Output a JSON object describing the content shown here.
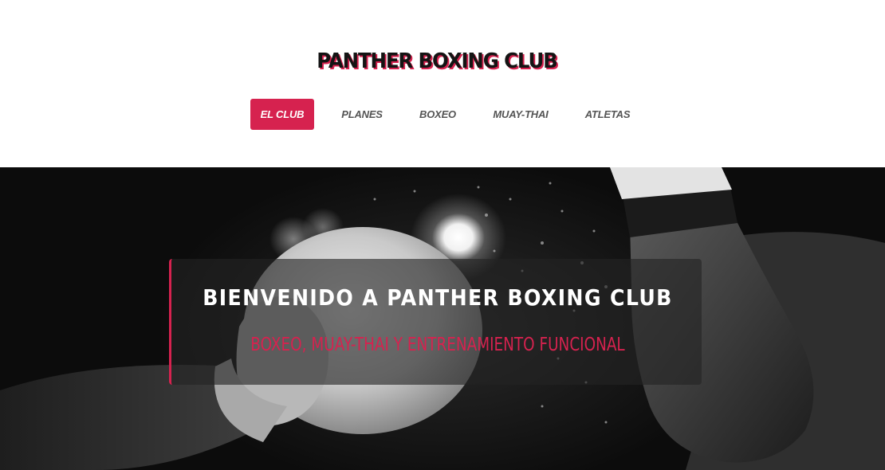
{
  "header": {
    "logo": "PANTHER BOXING CLUB"
  },
  "nav": {
    "items": [
      {
        "label": "EL CLUB",
        "active": true
      },
      {
        "label": "PLANES",
        "active": false
      },
      {
        "label": "BOXEO",
        "active": false
      },
      {
        "label": "MUAY-THAI",
        "active": false
      },
      {
        "label": "ATLETAS",
        "active": false
      }
    ]
  },
  "hero": {
    "title": "BIENVENIDO A PANTHER BOXING CLUB",
    "subtitle": "BOXEO, MUAY-THAI Y ENTRENAMIENTO FUNCIONAL"
  },
  "colors": {
    "accent": "#d6224f",
    "logo_text": "#141414",
    "nav_text": "#555555",
    "hero_bg": "#090909"
  }
}
